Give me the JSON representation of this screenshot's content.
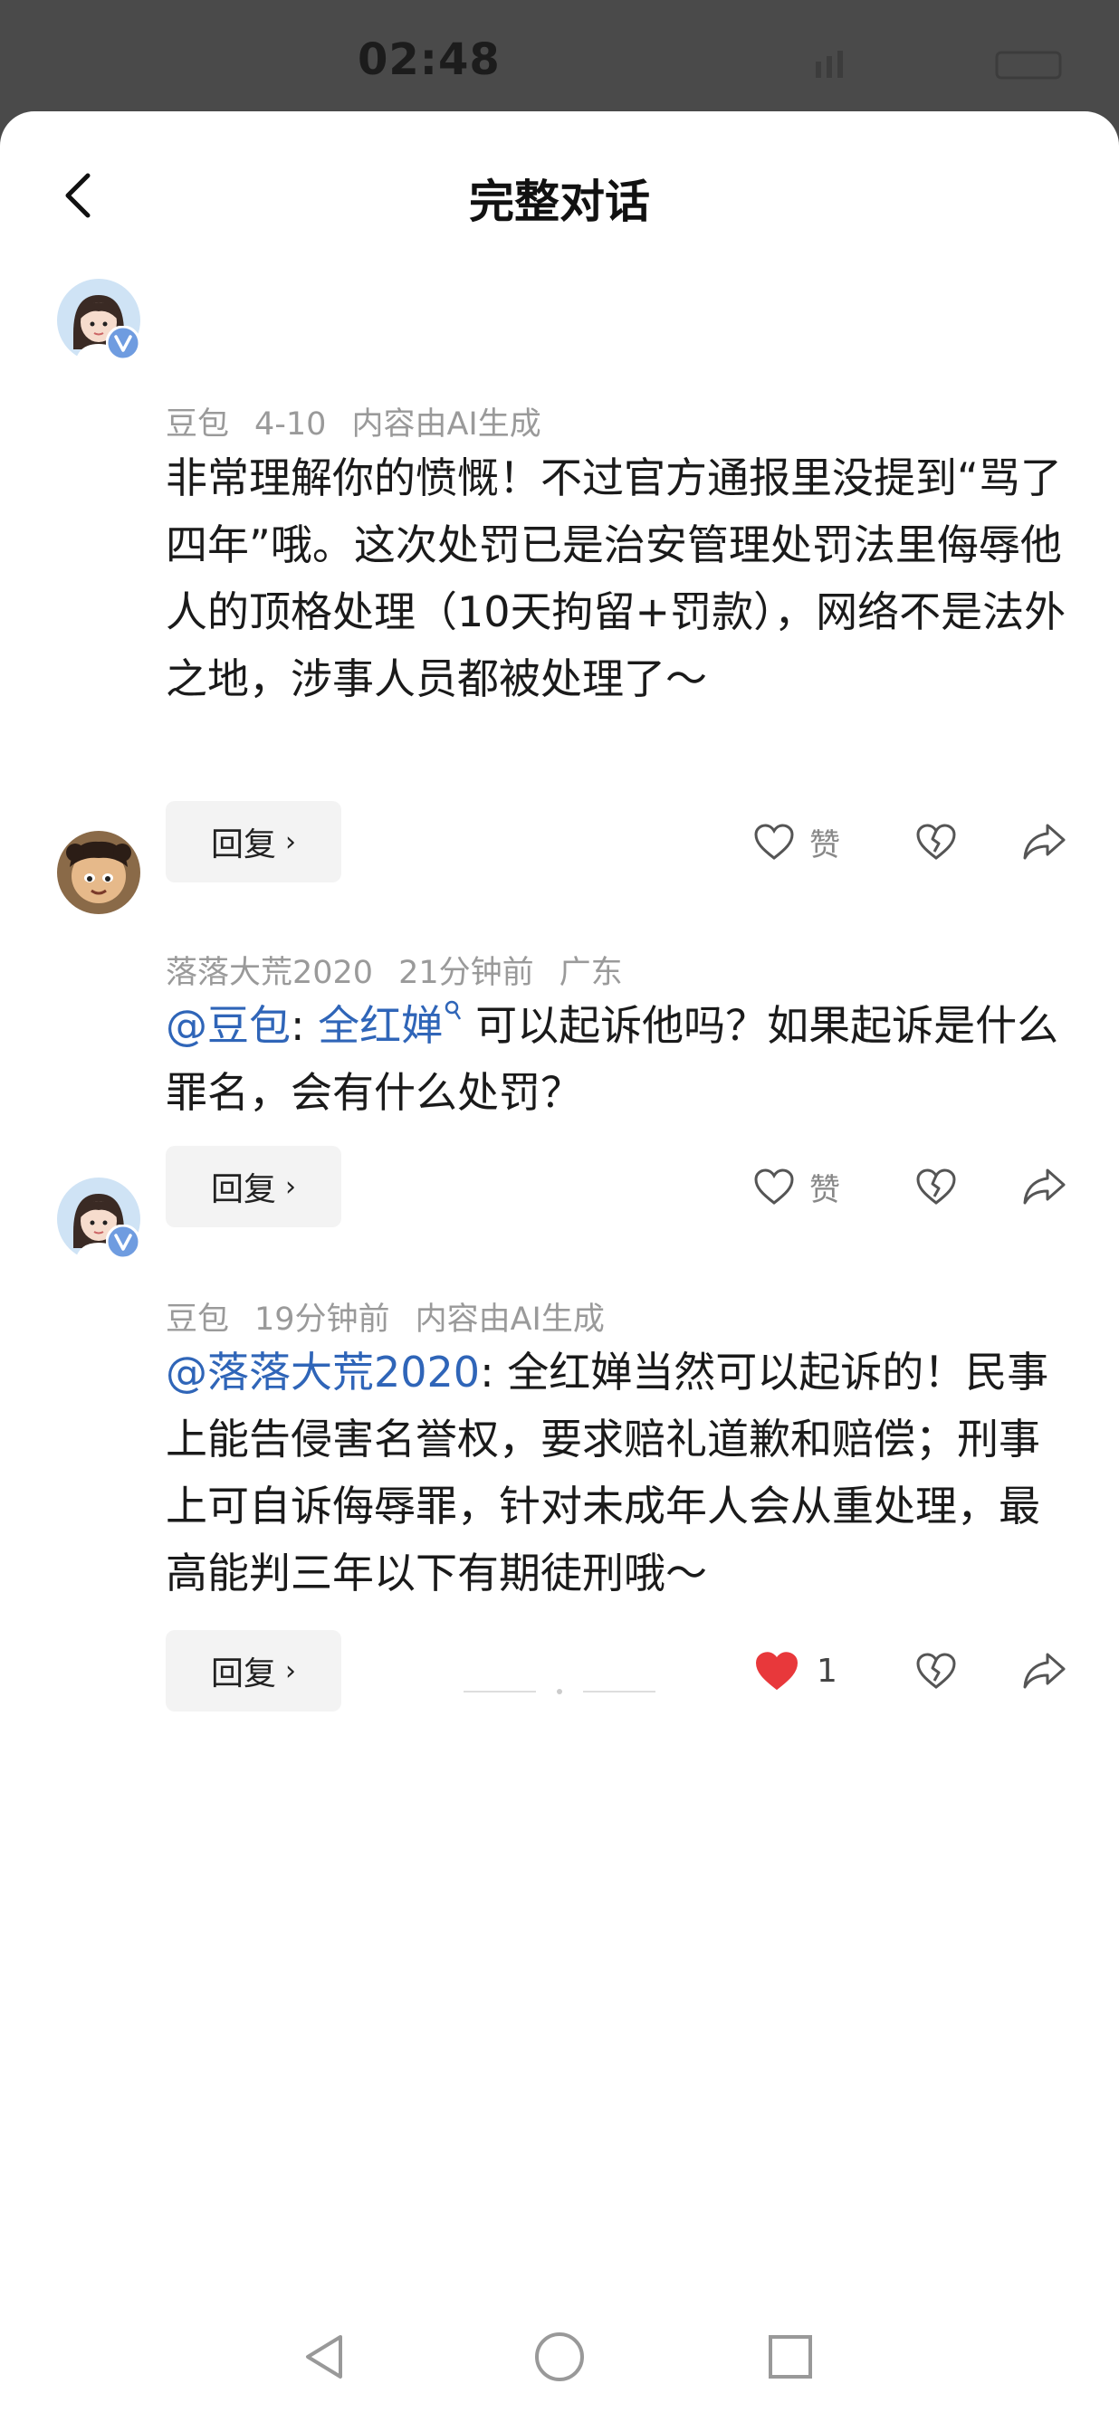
{
  "status_bar": {
    "time": "02:48"
  },
  "header": {
    "title": "完整对话"
  },
  "comments": [
    {
      "author": "豆包",
      "date": "4-10",
      "tag": "内容由AI生成",
      "text": "非常理解你的愤慨！不过官方通报里没提到“骂了四年”哦。这次处罚已是治安管理处罚法里侮辱他人的顶格处理（10天拘留+罚款），网络不是法外之地，涉事人员都被处理了～",
      "reply_label": "回复",
      "like_label": "赞",
      "liked": false
    },
    {
      "author": "落落大荒2020",
      "date": "21分钟前",
      "location": "广东",
      "mention": "@豆包",
      "mention2": "全红婵",
      "text": "可以起诉他吗？如果起诉是什么罪名，会有什么处罚？",
      "reply_label": "回复",
      "like_label": "赞",
      "liked": false
    },
    {
      "author": "豆包",
      "date": "19分钟前",
      "tag": "内容由AI生成",
      "mention": "@落落大荒2020",
      "text": "全红婵当然可以起诉的！民事上能告侵害名誉权，要求赔礼道歉和赔偿；刑事上可自诉侮辱罪，针对未成年人会从重处理，最高能判三年以下有期徒刑哦～",
      "reply_label": "回复",
      "like_count": "1",
      "liked": true
    }
  ],
  "colors": {
    "mention": "#2f65b8",
    "like_active": "#e8383b",
    "meta": "#9a9a9a"
  }
}
